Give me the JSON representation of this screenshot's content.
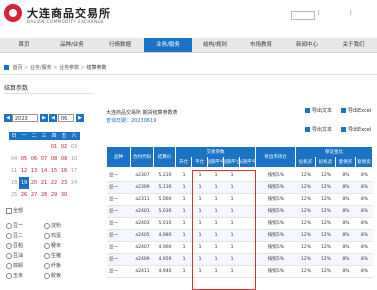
{
  "header": {
    "brand": "大连商品交易所",
    "brand_en": "DALIAN COMMODITY EXCHANGE",
    "links": [
      "|",
      "|"
    ]
  },
  "nav": {
    "items": [
      "首页",
      "品种/业务",
      "行情数据",
      "业务/服务",
      "结构/规则",
      "市场教育",
      "新闻中心",
      "关于我们"
    ],
    "active_index": 3
  },
  "breadcrumb": {
    "items": [
      "首页",
      "业务/服务",
      "业务参数",
      "结算参数"
    ],
    "separator": ">"
  },
  "panel": {
    "title": "结算参数",
    "year": "2023",
    "month": "06",
    "calendar": {
      "weekdays": [
        "日",
        "一",
        "二",
        "三",
        "四",
        "五",
        "六"
      ],
      "rows": [
        [
          "",
          "",
          "",
          "",
          "01",
          "02",
          "03"
        ],
        [
          "04",
          "05",
          "06",
          "07",
          "08",
          "09",
          "10"
        ],
        [
          "11",
          "12",
          "13",
          "14",
          "15",
          "16",
          "17"
        ],
        [
          "18",
          "19",
          "20",
          "21",
          "22",
          "23",
          "24"
        ],
        [
          "25",
          "26",
          "27",
          "28",
          "29",
          "30",
          ""
        ]
      ],
      "selected": "19"
    },
    "filter_all": "全部",
    "varieties": [
      "豆一",
      "豆二",
      "豆粕",
      "豆油",
      "棕榈",
      "玉米"
    ],
    "varieties_right": [
      "淀粉",
      "鸡蛋",
      "粳米",
      "生猪",
      "纤板",
      "胶板"
    ]
  },
  "content": {
    "notice": "大连商品交易所 期货结算参数表",
    "date_label": "查询日期：20230619",
    "downloads": [
      "导出文本",
      "导出Excel",
      "导出文本",
      "导出Excel"
    ]
  },
  "table": {
    "header_group_left": "交易参数",
    "header_group_right": "保证金比",
    "headers": [
      "品种",
      "合约代码",
      "结算价",
      "开仓",
      "平仓",
      "短期平今",
      "短期平仓",
      "长期平今",
      "单边市持仓",
      "投机买",
      "投机卖",
      "套保买",
      "套保卖"
    ],
    "rows": [
      [
        "豆一",
        "a2307",
        "5,230",
        "1",
        "1",
        "1",
        "1",
        "",
        "按照5%",
        "12%",
        "12%",
        "8%",
        "8%"
      ],
      [
        "豆一",
        "a2309",
        "5,130",
        "1",
        "1",
        "1",
        "1",
        "",
        "按照5%",
        "12%",
        "12%",
        "8%",
        "8%"
      ],
      [
        "豆一",
        "a2311",
        "5,060",
        "1",
        "1",
        "1",
        "1",
        "",
        "按照5%",
        "12%",
        "12%",
        "8%",
        "8%"
      ],
      [
        "豆一",
        "a2401",
        "5,030",
        "1",
        "1",
        "1",
        "1",
        "",
        "按照5%",
        "12%",
        "12%",
        "8%",
        "8%"
      ],
      [
        "豆一",
        "a2403",
        "5,010",
        "1",
        "1",
        "1",
        "1",
        "",
        "按照5%",
        "12%",
        "12%",
        "8%",
        "8%"
      ],
      [
        "豆一",
        "a2405",
        "4,980",
        "1",
        "1",
        "1",
        "1",
        "",
        "按照5%",
        "12%",
        "12%",
        "8%",
        "8%"
      ],
      [
        "豆一",
        "a2407",
        "4,960",
        "1",
        "1",
        "1",
        "1",
        "",
        "按照5%",
        "12%",
        "12%",
        "8%",
        "8%"
      ],
      [
        "豆一",
        "a2409",
        "4,950",
        "1",
        "1",
        "1",
        "1",
        "",
        "按照5%",
        "12%",
        "12%",
        "8%",
        "8%"
      ],
      [
        "豆一",
        "a2411",
        "4,940",
        "1",
        "1",
        "1",
        "1",
        "",
        "按照5%",
        "12%",
        "12%",
        "8%",
        "8%"
      ]
    ]
  },
  "colors": {
    "brand_red": "#d7232f",
    "accent_blue": "#1a73c4",
    "highlight_red": "#e03030"
  }
}
